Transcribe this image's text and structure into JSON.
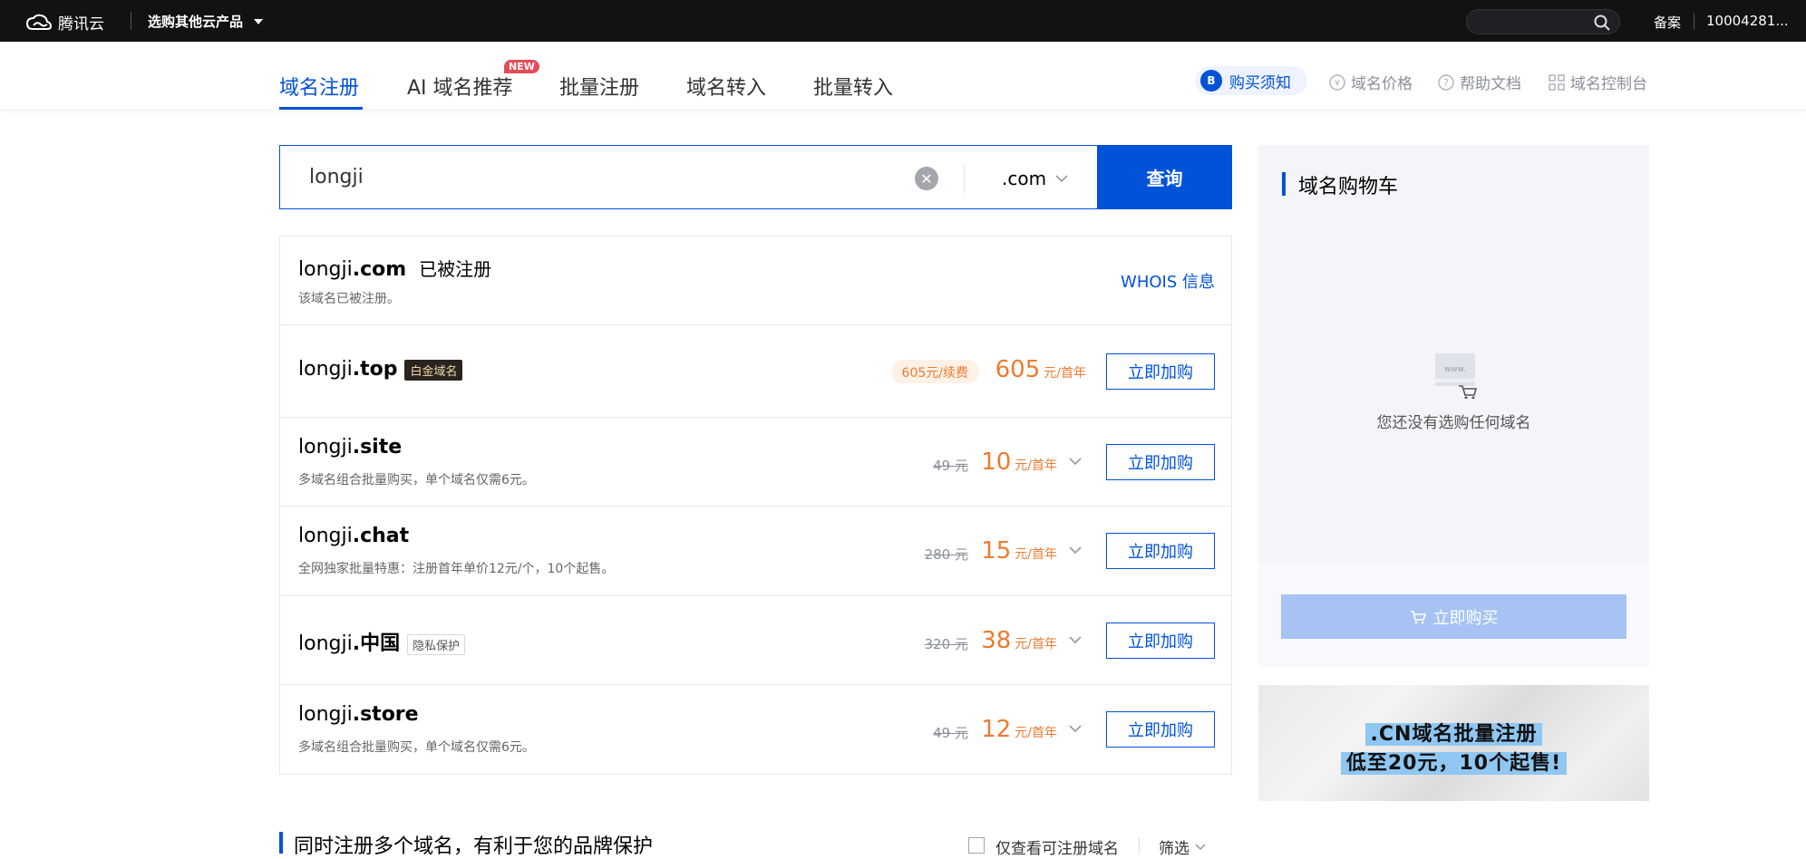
{
  "topbar": {
    "logo_text": "腾讯云",
    "products_label": "选购其他云产品",
    "record_label": "备案",
    "account_label": "10004281..."
  },
  "nav": {
    "tabs": [
      {
        "label": "域名注册",
        "active": true
      },
      {
        "label": "AI 域名推荐",
        "active": false
      },
      {
        "label": "批量注册",
        "active": false
      },
      {
        "label": "域名转入",
        "active": false
      },
      {
        "label": "批量转入",
        "active": false
      }
    ],
    "new_badge": "NEW",
    "notice_label": "购买须知",
    "links": [
      "域名价格",
      "帮助文档",
      "域名控制台"
    ]
  },
  "search": {
    "query": "longji",
    "suffix": ".com",
    "button_label": "查询"
  },
  "results": [
    {
      "name": "longji",
      "tld": ".com",
      "status": "已被注册",
      "sub": "该域名已被注册。",
      "whois": "WHOIS 信息"
    },
    {
      "name": "longji",
      "tld": ".top",
      "tag": "白金域名",
      "renew": "605元/续费",
      "price": "605",
      "unit": "元/首年",
      "buy": "立即加购"
    },
    {
      "name": "longji",
      "tld": ".site",
      "sub": "多域名组合批量购买，单个域名仅需6元。",
      "orig": "49 元",
      "price": "10",
      "unit": "元/首年",
      "buy": "立即加购"
    },
    {
      "name": "longji",
      "tld": ".chat",
      "sub": "全网独家批量特惠：注册首年单价12元/个，10个起售。",
      "orig": "280 元",
      "price": "15",
      "unit": "元/首年",
      "buy": "立即加购"
    },
    {
      "name": "longji",
      "tld": ".中国",
      "tag": "隐私保护",
      "orig": "320 元",
      "price": "38",
      "unit": "元/首年",
      "buy": "立即加购"
    },
    {
      "name": "longji",
      "tld": ".store",
      "sub": "多域名组合批量购买，单个域名仅需6元。",
      "orig": "49 元",
      "price": "12",
      "unit": "元/首年",
      "buy": "立即加购"
    }
  ],
  "cart": {
    "title": "域名购物车",
    "empty_icon_text": "www.",
    "empty_text": "您还没有选购任何域名",
    "buy_label": "立即购买"
  },
  "banner": {
    "line1": ".CN域名批量注册",
    "line2": "低至20元，10个起售!"
  },
  "bottom": {
    "heading": "同时注册多个域名，有利于您的品牌保护",
    "checkbox_label": "仅查看可注册域名",
    "filter_label": "筛选"
  },
  "colors": {
    "brand": "#0052d9",
    "price": "#ed7b2f",
    "topbar": "#121213"
  }
}
